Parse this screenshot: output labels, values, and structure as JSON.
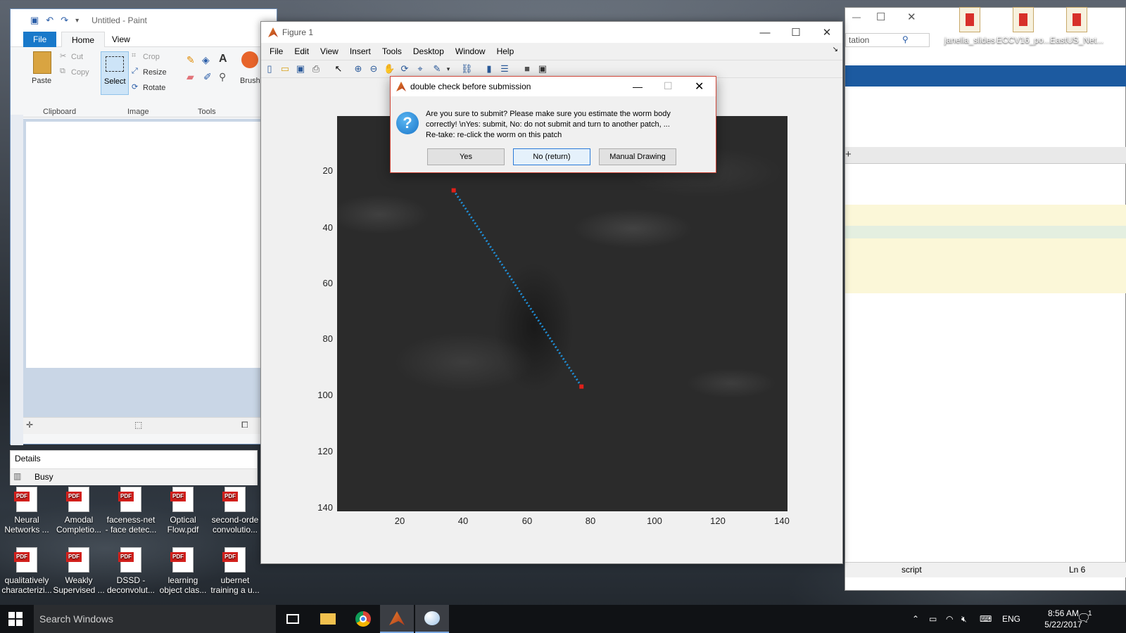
{
  "desktop": {
    "top_right_icons": [
      {
        "label": "janelia_slides"
      },
      {
        "label": "ECCV16_po..."
      },
      {
        "label": "EastUS_Net..."
      }
    ],
    "bottom_icons_row1": [
      {
        "label1": "Neural",
        "label2": "Networks ..."
      },
      {
        "label1": "Amodal",
        "label2": "Completio..."
      },
      {
        "label1": "faceness-net",
        "label2": "- face detec..."
      },
      {
        "label1": "Optical",
        "label2": "Flow.pdf"
      },
      {
        "label1": "second-orde",
        "label2": "convolutio..."
      }
    ],
    "bottom_icons_row2": [
      {
        "label1": "qualitatively",
        "label2": "characterizi..."
      },
      {
        "label1": "Weakly",
        "label2": "Supervised ..."
      },
      {
        "label1": "DSSD -",
        "label2": "deconvolut..."
      },
      {
        "label1": "learning",
        "label2": "object clas..."
      },
      {
        "label1": "ubernet",
        "label2": "training a u..."
      }
    ]
  },
  "paint": {
    "title": "Untitled - Paint",
    "tabs": {
      "file": "File",
      "home": "Home",
      "view": "View"
    },
    "clipboard": {
      "paste": "Paste",
      "cut": "Cut",
      "copy": "Copy",
      "group": "Clipboard"
    },
    "image": {
      "select": "Select",
      "crop": "Crop",
      "resize": "Resize",
      "rotate": "Rotate",
      "group": "Image"
    },
    "tools": {
      "group": "Tools",
      "brushes": "Brush"
    }
  },
  "details": {
    "title": "Details",
    "status": "Busy"
  },
  "back_window": {
    "search_fragment": "tation",
    "status_left": "script",
    "status_right": "Ln  6"
  },
  "figure": {
    "title": "Figure 1",
    "menus": [
      "File",
      "Edit",
      "View",
      "Insert",
      "Tools",
      "Desktop",
      "Window",
      "Help"
    ],
    "axes": {
      "yticks": [
        "20",
        "40",
        "60",
        "80",
        "100",
        "120",
        "140"
      ],
      "xticks": [
        "20",
        "40",
        "60",
        "80",
        "100",
        "120",
        "140"
      ]
    },
    "line": {
      "color": "#1f8fd8",
      "endpoint_color": "#e0201a",
      "start": [
        37,
        27
      ],
      "end": [
        77,
        97
      ]
    }
  },
  "dialog": {
    "title": "double check before submission",
    "line1": "Are you sure to submit? Please make sure you estimate the worm body",
    "line2": "correctly! \\nYes: submit, No: do not submit and turn to another patch, ...",
    "line3": "Re-take: re-click the worm on this patch",
    "buttons": {
      "yes": "Yes",
      "no": "No (return)",
      "manual": "Manual Drawing"
    }
  },
  "taskbar": {
    "search_placeholder": "Search Windows",
    "lang": "ENG",
    "time": "8:56 AM",
    "date": "5/22/2017",
    "notification_count": "1"
  }
}
